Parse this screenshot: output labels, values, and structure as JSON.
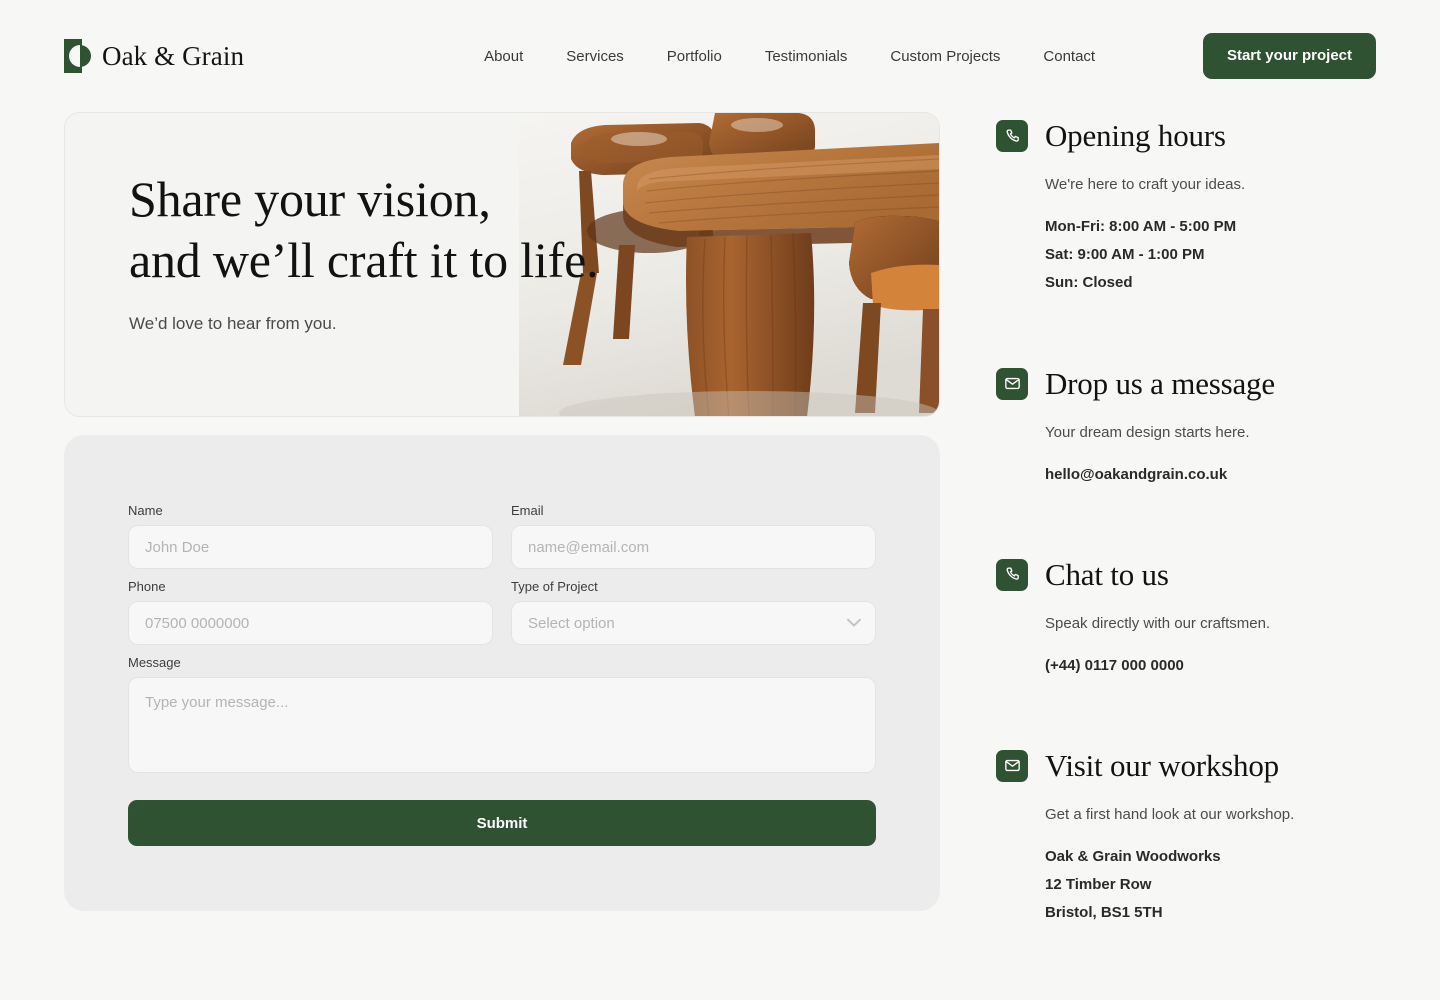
{
  "header": {
    "brand": {
      "name": "Oak & Grain",
      "logo_icon": "oak-grain-logo-icon"
    },
    "nav": [
      {
        "label": "About"
      },
      {
        "label": "Services"
      },
      {
        "label": "Portfolio"
      },
      {
        "label": "Testimonials"
      },
      {
        "label": "Custom Projects"
      },
      {
        "label": "Contact"
      }
    ],
    "cta_label": "Start your project"
  },
  "hero": {
    "title_line1": "Share your vision,",
    "title_line2": "and we’ll craft it to life.",
    "subtitle": "We’d love to hear from you.",
    "image_alt": "wooden-dining-table-and-chairs"
  },
  "form": {
    "name": {
      "label": "Name",
      "value": "",
      "placeholder": "John Doe"
    },
    "email": {
      "label": "Email",
      "value": "",
      "placeholder": "name@email.com"
    },
    "phone": {
      "label": "Phone",
      "value": "",
      "placeholder": "07500 0000000"
    },
    "project_type": {
      "label": "Type of Project",
      "value": "Select option",
      "options": [
        "Select option"
      ]
    },
    "message": {
      "label": "Message",
      "value": "",
      "placeholder": "Type your message..."
    },
    "submit_label": "Submit"
  },
  "contact_blocks": [
    {
      "icon": "phone-icon",
      "title": "Opening hours",
      "description": "We're here to craft your ideas.",
      "lines": [
        "Mon-Fri: 8:00 AM - 5:00 PM",
        "Sat: 9:00 AM - 1:00 PM",
        "Sun: Closed"
      ]
    },
    {
      "icon": "envelope-icon",
      "title": "Drop us a message",
      "description": "Your dream design starts here.",
      "lines": [
        "hello@oakandgrain.co.uk"
      ]
    },
    {
      "icon": "phone-icon",
      "title": "Chat to us",
      "description": "Speak directly with our craftsmen.",
      "lines": [
        "(+44) 0117 000 0000"
      ]
    },
    {
      "icon": "envelope-icon",
      "title": "Visit our workshop",
      "description": "Get a first hand look at our workshop.",
      "lines": [
        "Oak & Grain Woodworks",
        "12 Timber Row",
        "Bristol, BS1 5TH"
      ]
    }
  ],
  "colors": {
    "brand_green": "#2f5233",
    "page_background": "#f7f7f5",
    "form_card": "#ececec",
    "hero_card": "#f4f4f2"
  }
}
